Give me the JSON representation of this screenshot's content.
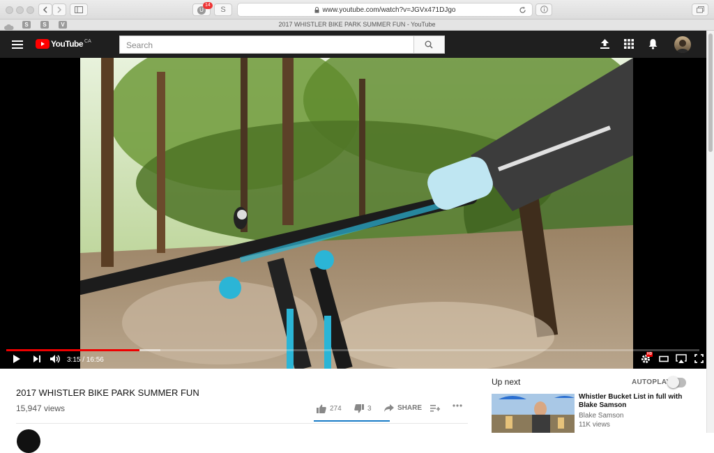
{
  "browser": {
    "url": "www.youtube.com/watch?v=JGVx471DJgo",
    "tab_title": "2017 WHISTLER BIKE PARK SUMMER FUN - YouTube",
    "extension_badge": "14",
    "extension_u": "U",
    "extension_s": "S",
    "favorites": [
      "S",
      "S",
      "V"
    ]
  },
  "header": {
    "logo_text": "YouTube",
    "logo_region": "CA",
    "search_placeholder": "Search"
  },
  "player": {
    "current_time": "3:15",
    "duration": "16:56",
    "time_display": "3:15 / 16:56",
    "played_fraction": 0.192,
    "loaded_fraction": 0.222,
    "hd_badge": "HD"
  },
  "video": {
    "title": "2017 WHISTLER BIKE PARK SUMMER FUN",
    "views": "15,947 views",
    "likes": "274",
    "dislikes": "3",
    "share_label": "SHARE",
    "like_ratio": 0.989
  },
  "sidebar": {
    "up_next_label": "Up next",
    "autoplay_label": "AUTOPLAY",
    "autoplay_on": false,
    "recommendations": [
      {
        "title": "Whistler Bucket List in full with Blake Samson",
        "channel": "Blake Samson",
        "views": "11K views"
      }
    ]
  },
  "colors": {
    "youtube_red": "#ff0000",
    "progress_red": "#ee0000",
    "header_bg": "#1f1f1f",
    "accent_blue": "#167ac6"
  }
}
